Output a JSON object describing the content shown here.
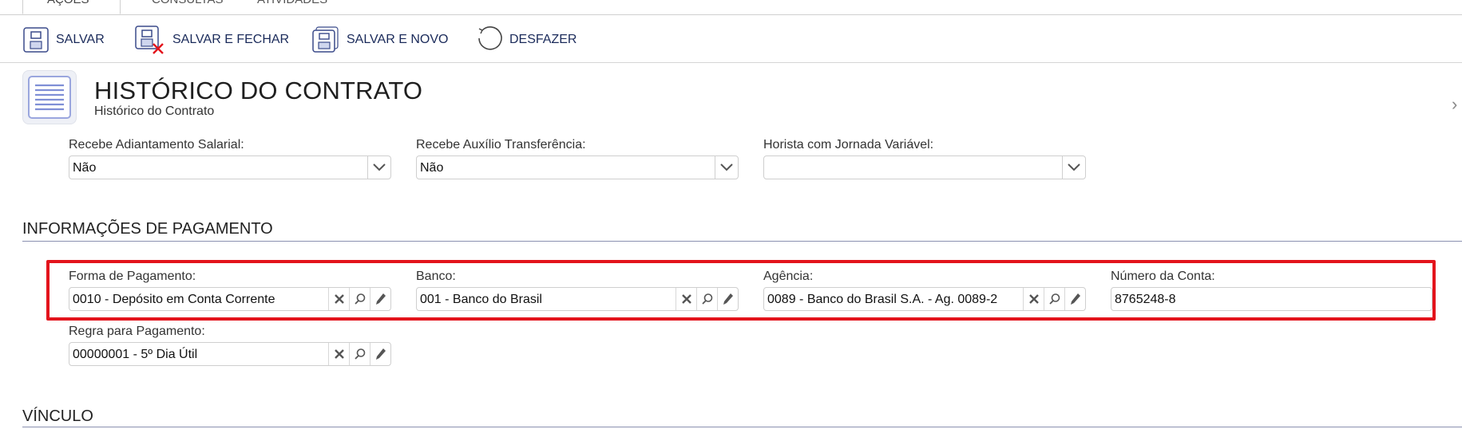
{
  "tabs": [
    {
      "label": "AÇÕES",
      "active": true
    },
    {
      "label": "CONSULTAS",
      "active": false
    },
    {
      "label": "ATIVIDADES",
      "active": false
    }
  ],
  "toolbar": {
    "save_label": "SALVAR",
    "save_close_label": "SALVAR E FECHAR",
    "save_new_label": "SALVAR E NOVO",
    "undo_label": "DESFAZER"
  },
  "header": {
    "title": "HISTÓRICO DO CONTRATO",
    "subtitle": "Histórico do Contrato"
  },
  "fields_top": [
    {
      "label": "Recebe Adiantamento Salarial:",
      "value": "Não"
    },
    {
      "label": "Recebe Auxílio Transferência:",
      "value": "Não"
    },
    {
      "label": "Horista com Jornada Variável:",
      "value": ""
    }
  ],
  "sections": {
    "payment": "INFORMAÇÕES DE PAGAMENTO",
    "bond": "VÍNCULO"
  },
  "payment": {
    "forma": {
      "label": "Forma de Pagamento:",
      "value": "0010 - Depósito em Conta Corrente"
    },
    "banco": {
      "label": "Banco:",
      "value": "001 - Banco do Brasil"
    },
    "agencia": {
      "label": "Agência:",
      "value": "0089 - Banco do Brasil S.A. - Ag. 0089-2"
    },
    "conta": {
      "label": "Número da Conta:",
      "value": "8765248-8"
    },
    "regra": {
      "label": "Regra para Pagamento:",
      "value": "00000001 - 5º Dia Útil"
    }
  },
  "colors": {
    "accent": "#1a2a5a",
    "highlight": "#e3141c"
  }
}
